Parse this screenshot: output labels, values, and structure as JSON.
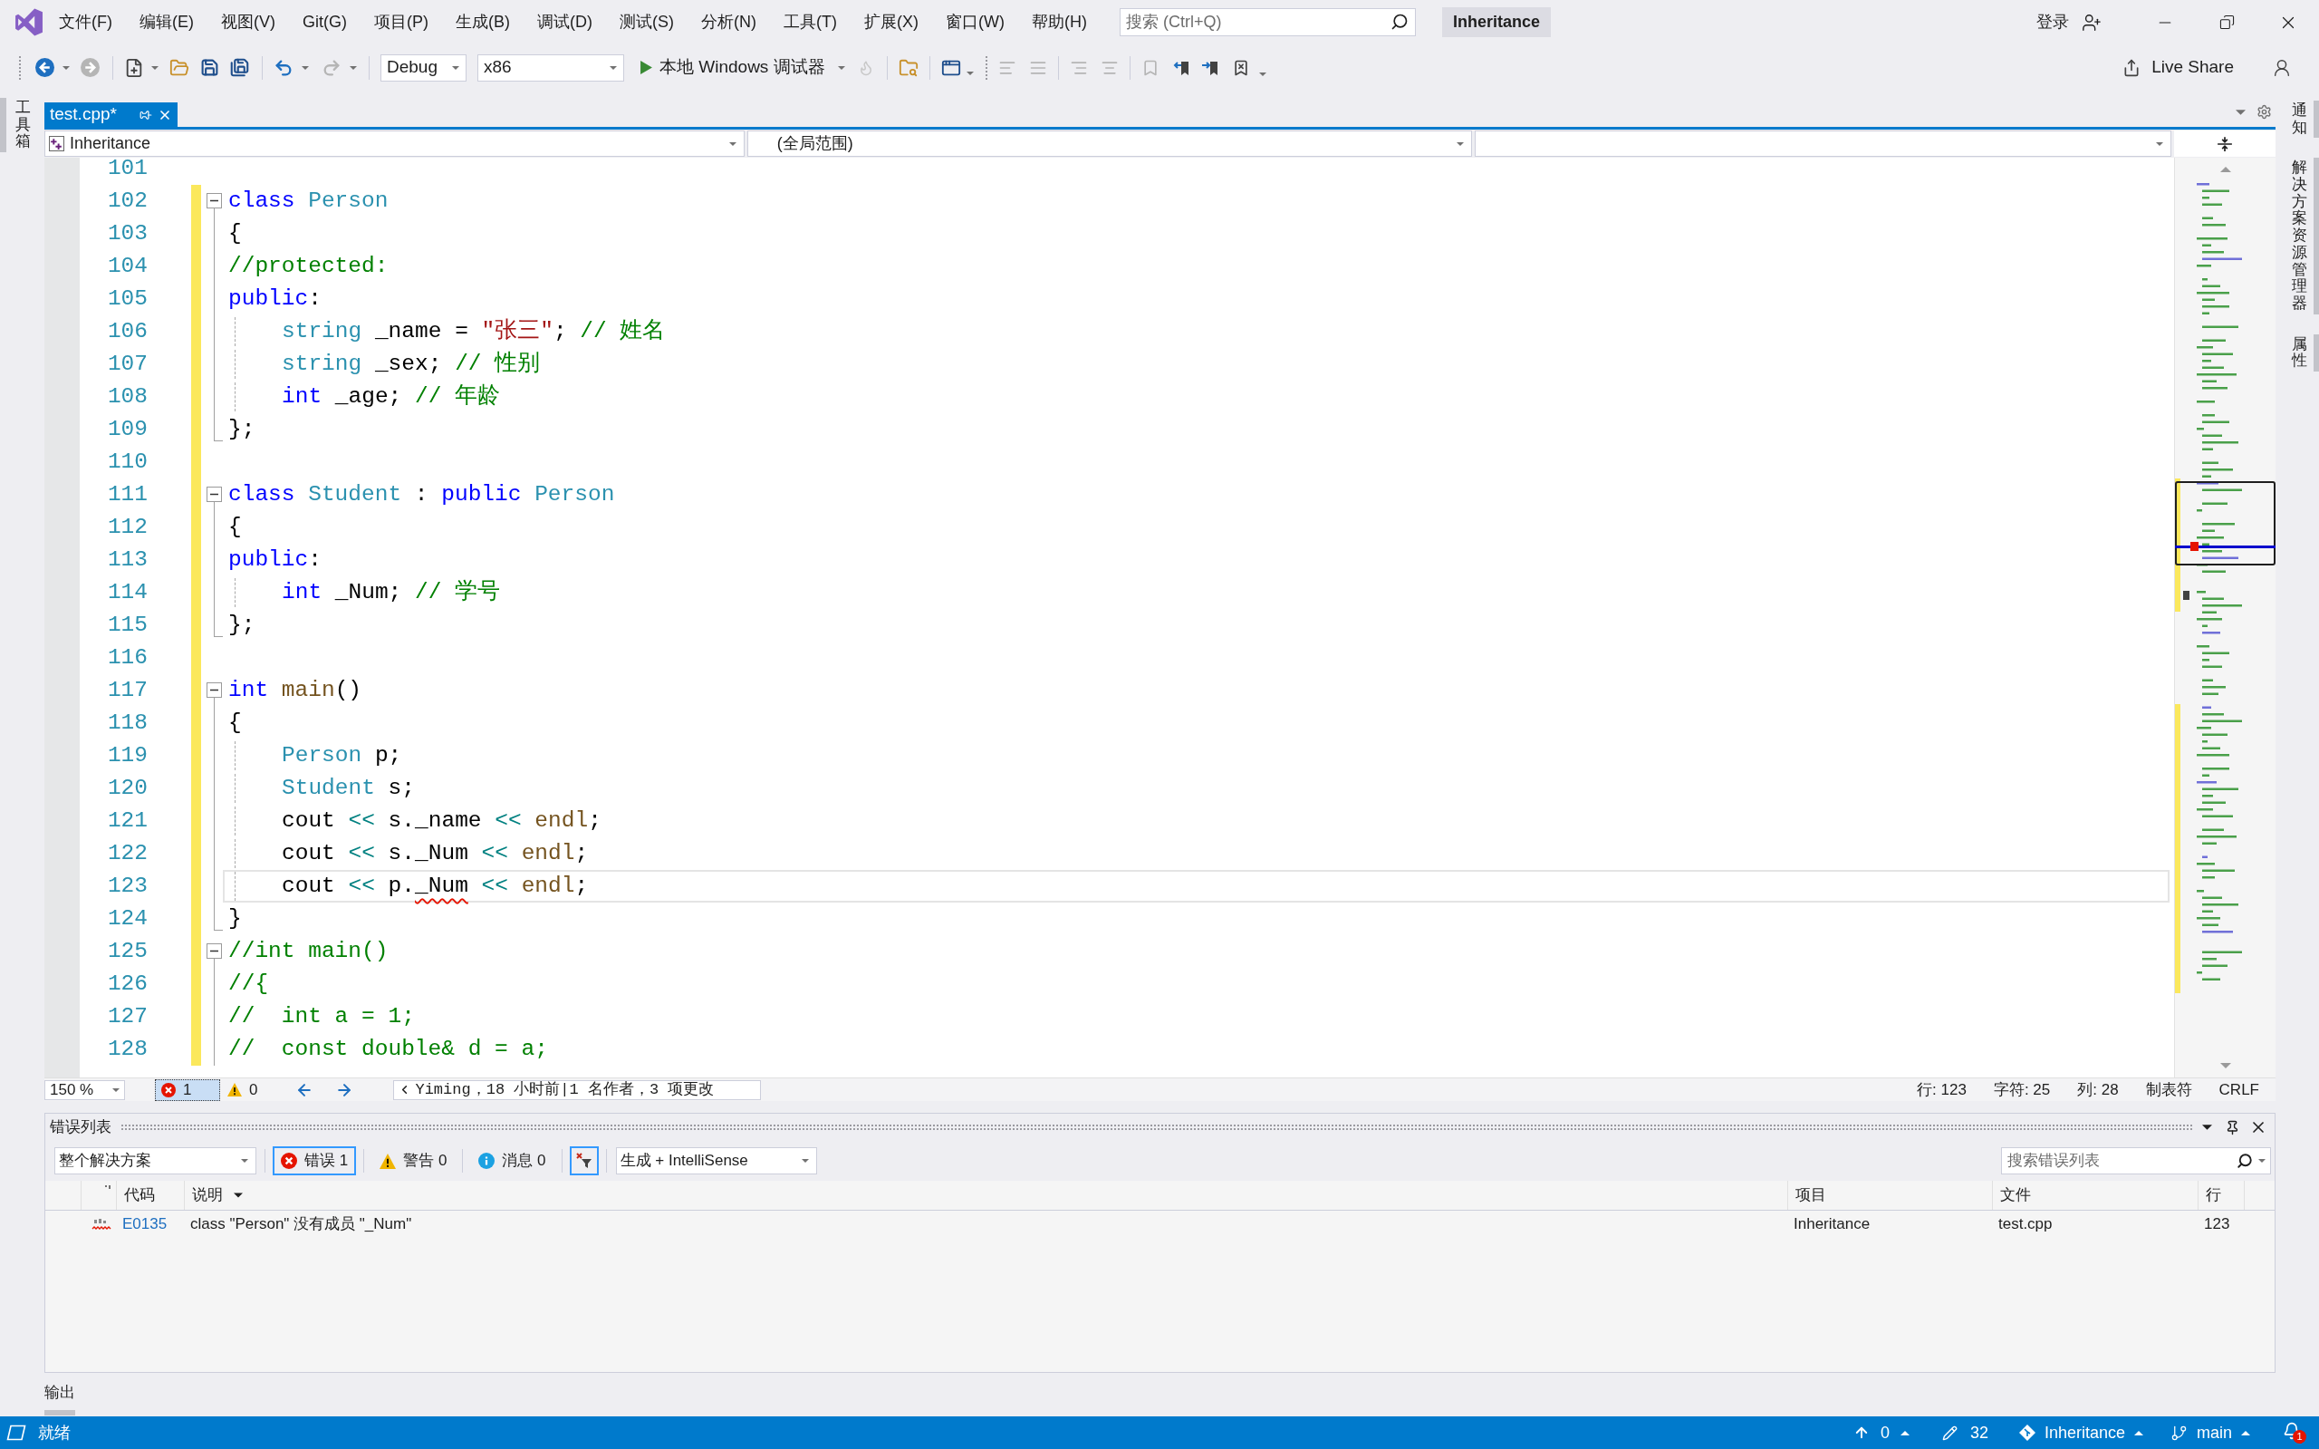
{
  "menu_bar": {
    "items": [
      "文件(F)",
      "编辑(E)",
      "视图(V)",
      "Git(G)",
      "项目(P)",
      "生成(B)",
      "调试(D)",
      "测试(S)",
      "分析(N)",
      "工具(T)",
      "扩展(X)",
      "窗口(W)",
      "帮助(H)"
    ],
    "search": {
      "placeholder": "搜索 (Ctrl+Q)"
    },
    "solution_name": "Inheritance",
    "sign_in": "登录"
  },
  "toolbar": {
    "configuration": "Debug",
    "platform": "x86",
    "run_target": "本地 Windows 调试器",
    "live_share": "Live Share"
  },
  "left_tool_tabs": [
    {
      "label": "工具箱"
    }
  ],
  "document_tabs": [
    {
      "label": "test.cpp*",
      "selected": true
    }
  ],
  "navigation_bar": {
    "project": "Inheritance",
    "scope": "(全局范围)"
  },
  "editor": {
    "lines": [
      {
        "number": "101",
        "kind": "plain",
        "changed": false,
        "current": false
      },
      {
        "number": "102",
        "kind": "start",
        "changed": true,
        "current": false,
        "indented": false,
        "tokens": [
          {
            "kind": "keyword",
            "text": "class"
          },
          {
            "kind": "type",
            "text": " Person"
          }
        ]
      },
      {
        "number": "103",
        "kind": "inside",
        "changed": true,
        "current": false,
        "indented": false,
        "tokens": [
          {
            "kind": "plain",
            "text": "{"
          }
        ]
      },
      {
        "number": "104",
        "kind": "inside",
        "changed": true,
        "current": false,
        "indented": false,
        "tokens": [
          {
            "kind": "comment",
            "text": "//protected:"
          }
        ]
      },
      {
        "number": "105",
        "kind": "inside",
        "changed": true,
        "current": false,
        "indented": false,
        "tokens": [
          {
            "kind": "keyword",
            "text": "public"
          },
          {
            "kind": "plain",
            "text": ":"
          }
        ]
      },
      {
        "number": "106",
        "kind": "inside",
        "changed": true,
        "current": false,
        "indented": true,
        "tokens": [
          {
            "kind": "type",
            "text": "string"
          },
          {
            "kind": "plain",
            "text": " _name = "
          },
          {
            "kind": "string",
            "text": "\"张三\""
          },
          {
            "kind": "plain",
            "text": "; "
          },
          {
            "kind": "comment",
            "text": "// 姓名"
          }
        ]
      },
      {
        "number": "107",
        "kind": "inside",
        "changed": true,
        "current": false,
        "indented": true,
        "tokens": [
          {
            "kind": "type",
            "text": "string"
          },
          {
            "kind": "plain",
            "text": " _sex; "
          },
          {
            "kind": "comment",
            "text": "// 性别"
          }
        ]
      },
      {
        "number": "108",
        "kind": "inside",
        "changed": true,
        "current": false,
        "indented": true,
        "tokens": [
          {
            "kind": "keyword",
            "text": "int"
          },
          {
            "kind": "plain",
            "text": " _age; "
          },
          {
            "kind": "comment",
            "text": "// 年龄"
          }
        ]
      },
      {
        "number": "109",
        "kind": "end",
        "changed": true,
        "current": false,
        "indented": false,
        "tokens": [
          {
            "kind": "plain",
            "text": "};"
          }
        ]
      },
      {
        "number": "110",
        "kind": "plain",
        "changed": true,
        "current": false
      },
      {
        "number": "111",
        "kind": "start",
        "changed": true,
        "current": false,
        "indented": false,
        "tokens": [
          {
            "kind": "keyword",
            "text": "class"
          },
          {
            "kind": "type",
            "text": " Student"
          },
          {
            "kind": "plain",
            "text": " : "
          },
          {
            "kind": "keyword",
            "text": "public"
          },
          {
            "kind": "type",
            "text": " Person"
          }
        ]
      },
      {
        "number": "112",
        "kind": "inside",
        "changed": true,
        "current": false,
        "indented": false,
        "tokens": [
          {
            "kind": "plain",
            "text": "{"
          }
        ]
      },
      {
        "number": "113",
        "kind": "inside",
        "changed": true,
        "current": false,
        "indented": false,
        "tokens": [
          {
            "kind": "keyword",
            "text": "public"
          },
          {
            "kind": "plain",
            "text": ":"
          }
        ]
      },
      {
        "number": "114",
        "kind": "inside",
        "changed": true,
        "current": false,
        "indented": true,
        "tokens": [
          {
            "kind": "keyword",
            "text": "int"
          },
          {
            "kind": "plain",
            "text": " _Num; "
          },
          {
            "kind": "comment",
            "text": "// 学号"
          }
        ]
      },
      {
        "number": "115",
        "kind": "end",
        "changed": true,
        "current": false,
        "indented": false,
        "tokens": [
          {
            "kind": "plain",
            "text": "};"
          }
        ]
      },
      {
        "number": "116",
        "kind": "plain",
        "changed": true,
        "current": false
      },
      {
        "number": "117",
        "kind": "start",
        "changed": true,
        "current": false,
        "indented": false,
        "tokens": [
          {
            "kind": "keyword",
            "text": "int"
          },
          {
            "kind": "function",
            "text": " main"
          },
          {
            "kind": "plain",
            "text": "()"
          }
        ]
      },
      {
        "number": "118",
        "kind": "inside",
        "changed": true,
        "current": false,
        "indented": false,
        "tokens": [
          {
            "kind": "plain",
            "text": "{"
          }
        ]
      },
      {
        "number": "119",
        "kind": "inside",
        "changed": true,
        "current": false,
        "indented": true,
        "tokens": [
          {
            "kind": "type",
            "text": "Person"
          },
          {
            "kind": "plain",
            "text": " p;"
          }
        ]
      },
      {
        "number": "120",
        "kind": "inside",
        "changed": true,
        "current": false,
        "indented": true,
        "tokens": [
          {
            "kind": "type",
            "text": "Student"
          },
          {
            "kind": "plain",
            "text": " s;"
          }
        ]
      },
      {
        "number": "121",
        "kind": "inside",
        "changed": true,
        "current": false,
        "indented": true,
        "tokens": [
          {
            "kind": "plain",
            "text": "cout "
          },
          {
            "kind": "operator",
            "text": "<<"
          },
          {
            "kind": "plain",
            "text": " s._name "
          },
          {
            "kind": "operator",
            "text": "<<"
          },
          {
            "kind": "function",
            "text": " endl"
          },
          {
            "kind": "plain",
            "text": ";"
          }
        ]
      },
      {
        "number": "122",
        "kind": "inside",
        "changed": true,
        "current": false,
        "indented": true,
        "tokens": [
          {
            "kind": "plain",
            "text": "cout "
          },
          {
            "kind": "operator",
            "text": "<<"
          },
          {
            "kind": "plain",
            "text": " s._Num "
          },
          {
            "kind": "operator",
            "text": "<<"
          },
          {
            "kind": "function",
            "text": " endl"
          },
          {
            "kind": "plain",
            "text": ";"
          }
        ]
      },
      {
        "number": "123",
        "kind": "inside",
        "changed": true,
        "current": true,
        "indented": true,
        "tokens": [
          {
            "kind": "plain",
            "text": "cout "
          },
          {
            "kind": "operator",
            "text": "<<"
          },
          {
            "kind": "plain",
            "text": " p."
          },
          {
            "kind": "error",
            "text": "_Num"
          },
          {
            "kind": "operator",
            "text": " <<"
          },
          {
            "kind": "function",
            "text": " endl"
          },
          {
            "kind": "plain",
            "text": ";"
          }
        ]
      },
      {
        "number": "124",
        "kind": "end",
        "changed": true,
        "current": false,
        "indented": false,
        "tokens": [
          {
            "kind": "plain",
            "text": "}"
          }
        ]
      },
      {
        "number": "125",
        "kind": "start",
        "changed": true,
        "current": false,
        "indented": false,
        "tokens": [
          {
            "kind": "comment",
            "text": "//int main()"
          }
        ]
      },
      {
        "number": "126",
        "kind": "inside",
        "changed": true,
        "current": false,
        "indented": false,
        "tokens": [
          {
            "kind": "comment",
            "text": "//{"
          }
        ]
      },
      {
        "number": "127",
        "kind": "inside",
        "changed": true,
        "current": false,
        "indented": false,
        "tokens": [
          {
            "kind": "comment",
            "text": "//  int a = 1;"
          }
        ]
      },
      {
        "number": "128",
        "kind": "inside",
        "changed": true,
        "current": false,
        "indented": false,
        "tokens": [
          {
            "kind": "comment",
            "text": "//  const double& d = a;"
          }
        ]
      }
    ]
  },
  "editor_footer": {
    "zoom": "150 %",
    "error_count": "1",
    "warning_count": "0",
    "codelens": "Yiming，18 小时前|1 名作者，3 项更改",
    "position": [
      "行: 123",
      "字符: 25",
      "列: 28",
      "制表符",
      "CRLF"
    ]
  },
  "error_list": {
    "title": "错误列表",
    "scope": "整个解决方案",
    "filters": [
      {
        "kind": "error",
        "label": "错误 1",
        "selected": true
      },
      {
        "kind": "warning",
        "label": "警告 0",
        "selected": false
      },
      {
        "kind": "message",
        "label": "消息 0",
        "selected": false
      }
    ],
    "filter_toggle": {
      "on": true
    },
    "source": "生成 + IntelliSense",
    "search": {
      "placeholder": "搜索错误列表"
    },
    "columns": [
      {
        "label": "代码",
        "sorted": false
      },
      {
        "label": "说明",
        "sorted": true
      },
      {
        "label": "项目",
        "sorted": false
      },
      {
        "label": "文件",
        "sorted": false
      },
      {
        "label": "行",
        "sorted": false
      }
    ],
    "rows": [
      {
        "code": "E0135",
        "description": "class \"Person\" 没有成员 \"_Num\"",
        "project": "Inheritance",
        "file": "test.cpp",
        "line": "123"
      }
    ]
  },
  "output_tab": {
    "label": "输出"
  },
  "right_tool_tabs": [
    {
      "label": "通知"
    },
    {
      "label": "解决方案资源管理器"
    },
    {
      "label": "属性"
    }
  ],
  "status_bar": {
    "state": "就绪",
    "push": "0",
    "edits": "32",
    "repository": "Inheritance",
    "branch": "main",
    "notifications": "1"
  }
}
